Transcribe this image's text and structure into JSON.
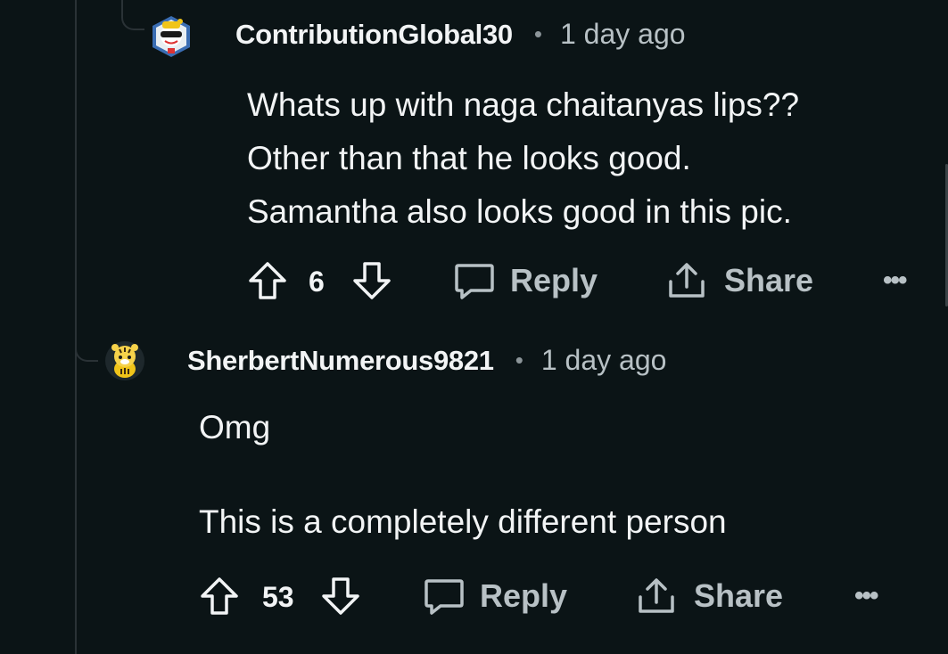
{
  "comments": [
    {
      "username": "ContributionGlobal30",
      "time": "1 day ago",
      "body": [
        "Whats up with naga chaitanyas lips??",
        "Other than that he looks good.",
        "Samantha also looks good in this pic."
      ],
      "votes": "6",
      "reply_label": "Reply",
      "share_label": "Share",
      "avatar_icon": "snoo-sunglasses-avatar"
    },
    {
      "username": "SherbertNumerous9821",
      "time": "1 day ago",
      "body": [
        "Omg",
        "",
        "This is a completely different person"
      ],
      "votes": "53",
      "reply_label": "Reply",
      "share_label": "Share",
      "avatar_icon": "tiger-avatar"
    }
  ],
  "separator": "•",
  "more_label": "•••",
  "colors": {
    "background": "#0b1416",
    "text": "#f2f4f5",
    "muted": "#b8c1c5",
    "thread_line": "#2a3236"
  }
}
